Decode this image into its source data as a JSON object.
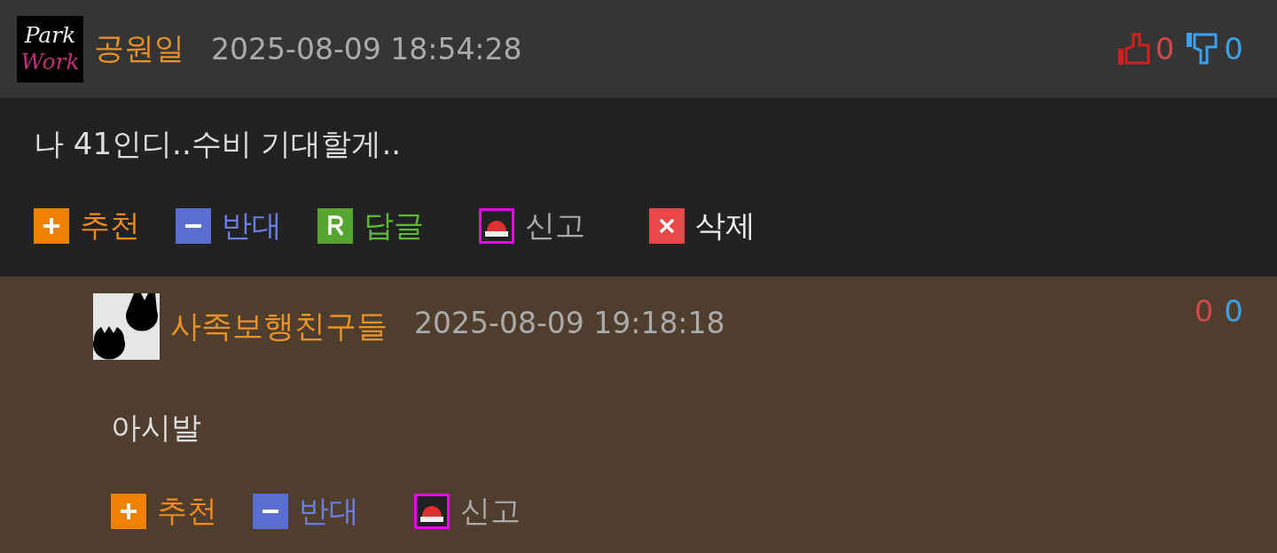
{
  "comments": [
    {
      "avatar": {
        "kind": "logo",
        "lines": [
          "Park",
          "Work"
        ]
      },
      "author": "공원일",
      "time": "2025-08-09 18:54:28",
      "show_vote_icons": true,
      "likes": "0",
      "dislikes": "0",
      "body": "나 41인디..수비 기대할게..",
      "is_reply": false,
      "actions": [
        {
          "kind": "recommend",
          "label": "추천"
        },
        {
          "kind": "oppose",
          "label": "반대"
        },
        {
          "kind": "reply",
          "label": "답글"
        },
        {
          "kind": "report",
          "label": "신고"
        },
        {
          "kind": "delete",
          "label": "삭제"
        }
      ]
    },
    {
      "avatar": {
        "kind": "paws"
      },
      "author": "사족보행친구들",
      "time": "2025-08-09 19:18:18",
      "show_vote_icons": false,
      "likes": "0",
      "dislikes": "0",
      "body": "아시발",
      "is_reply": true,
      "actions": [
        {
          "kind": "recommend",
          "label": "추천"
        },
        {
          "kind": "oppose",
          "label": "반대"
        },
        {
          "kind": "report",
          "label": "신고"
        }
      ]
    }
  ]
}
